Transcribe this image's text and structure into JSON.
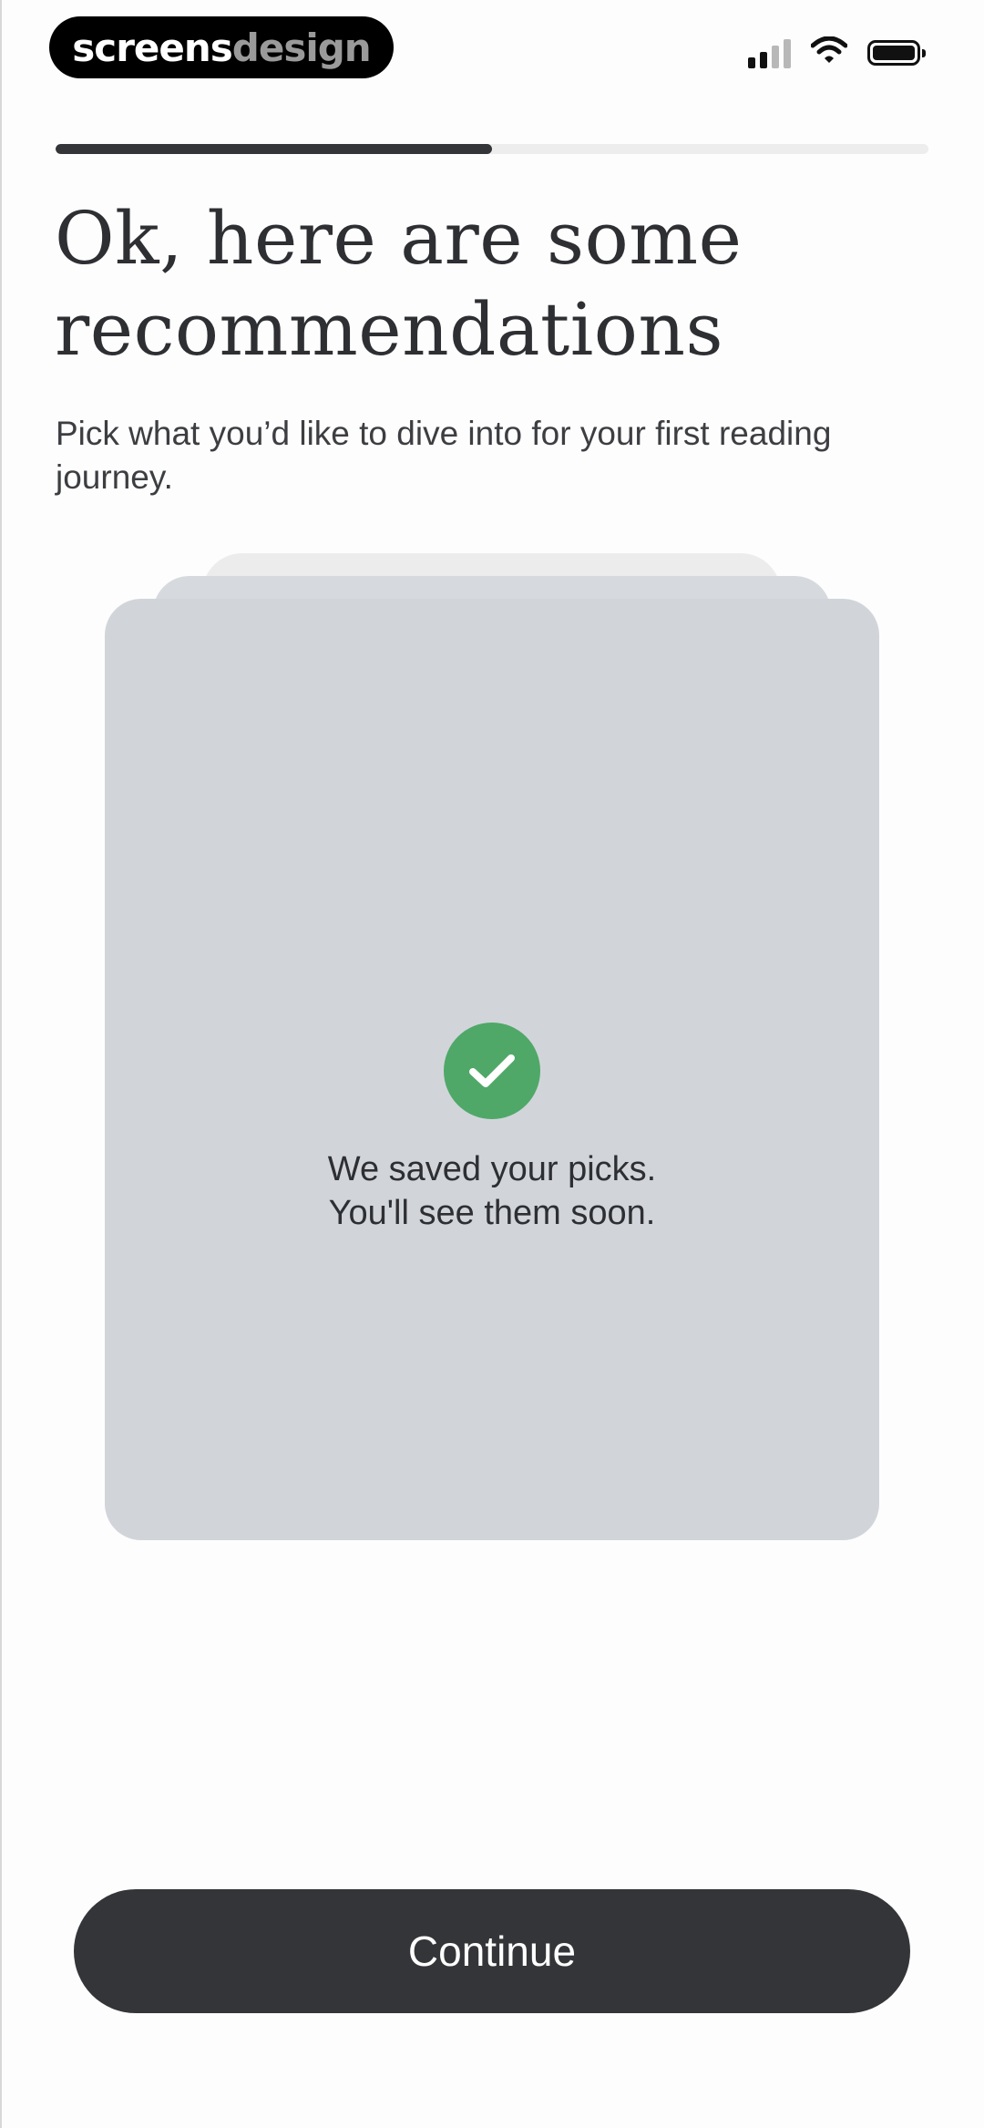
{
  "status_bar": {
    "brand_part1": "screens",
    "brand_part2": "design",
    "signal_bars": 2,
    "battery_level": 1.0
  },
  "onboarding": {
    "progress": 0.5,
    "title": "Ok, here are some recommendations",
    "subtitle": "Pick what you’d like to dive into for your first reading journey."
  },
  "card": {
    "icon": "check-circle-icon",
    "message_line1": "We saved your picks.",
    "message_line2": "You'll see them soon.",
    "colors": {
      "card": "#d1d5da",
      "check": "#4fa868"
    }
  },
  "footer": {
    "continue_label": "Continue",
    "button_color": "#343538"
  }
}
